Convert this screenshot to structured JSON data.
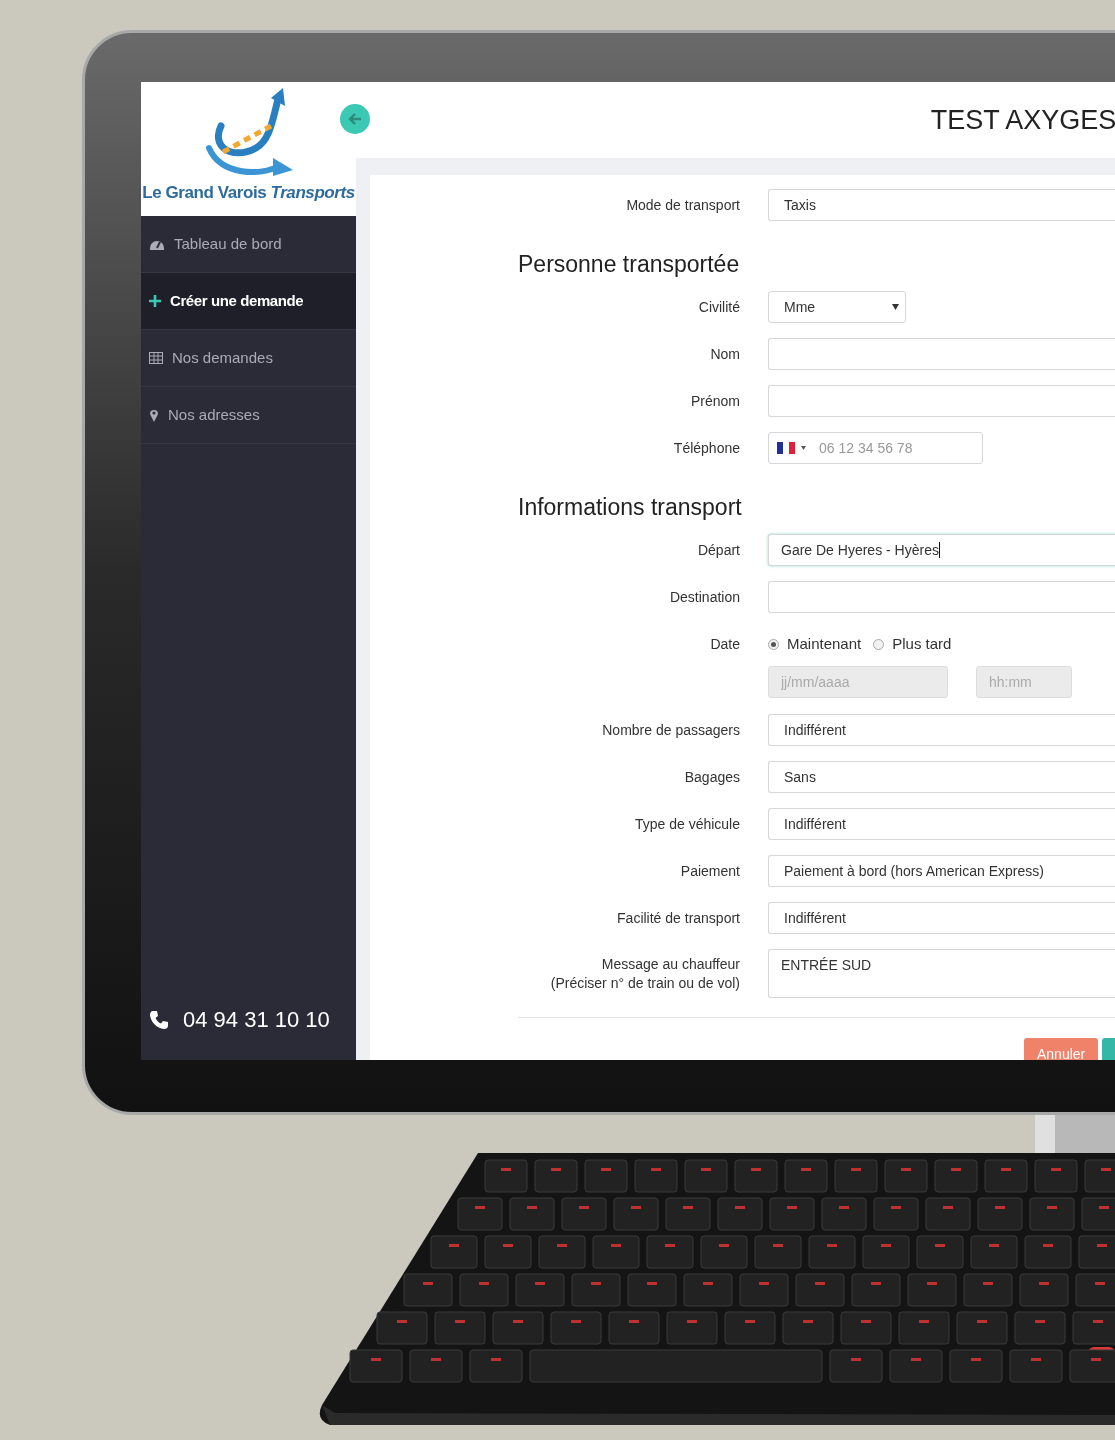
{
  "brand": {
    "name": "Le Grand Varois *Transports*"
  },
  "sidebar": {
    "items": [
      {
        "label": "Tableau de bord",
        "selected": false
      },
      {
        "label": "Créer une demande",
        "selected": true
      },
      {
        "label": "Nos demandes",
        "selected": false
      },
      {
        "label": "Nos adresses",
        "selected": false
      }
    ],
    "phone": "04 94 31 10 10"
  },
  "header": {
    "title": "TEST AXYGES"
  },
  "form": {
    "rows": [
      {
        "kind": "select",
        "label": "Mode de transport",
        "value": "Taxis"
      },
      {
        "kind": "heading",
        "label": "Personne transportée"
      },
      {
        "kind": "dropdown",
        "label": "Civilité",
        "value": "Mme"
      },
      {
        "kind": "input",
        "label": "Nom",
        "focused": false
      },
      {
        "kind": "input",
        "label": "Prénom",
        "focused": false
      },
      {
        "kind": "phone",
        "label": "Téléphone",
        "placeholder": "06 12 34 56 78"
      },
      {
        "kind": "heading",
        "label": "Informations transport"
      },
      {
        "kind": "input",
        "label": "Départ",
        "value": "Gare De Hyeres - Hyères",
        "focused": true
      },
      {
        "kind": "input",
        "label": "Destination",
        "focused": false
      },
      {
        "kind": "date",
        "label": "Date",
        "options": [
          {
            "label": "Maintenant",
            "selected": true
          },
          {
            "label": "Plus tard",
            "selected": false
          }
        ],
        "date_placeholder": "jj/mm/aaaa",
        "time_placeholder": "hh:mm",
        "disabled": true
      },
      {
        "kind": "select",
        "label": "Nombre de passagers",
        "value": "Indifférent"
      },
      {
        "kind": "select",
        "label": "Bagages",
        "value": "Sans"
      },
      {
        "kind": "select",
        "label": "Type de véhicule",
        "value": "Indifférent"
      },
      {
        "kind": "select",
        "label": "Paiement",
        "value": "Paiement à bord (hors American Express)"
      },
      {
        "kind": "select",
        "label": "Facilité de transport",
        "value": "Indifférent"
      },
      {
        "kind": "textarea",
        "label": "Message au chauffeur",
        "hint": "(Préciser n° de train ou de vol)",
        "value": "ENTRÉE SUD"
      }
    ],
    "buttons": [
      {
        "kind": "cancel",
        "label": "Annuler"
      },
      {
        "kind": "submit"
      }
    ]
  }
}
